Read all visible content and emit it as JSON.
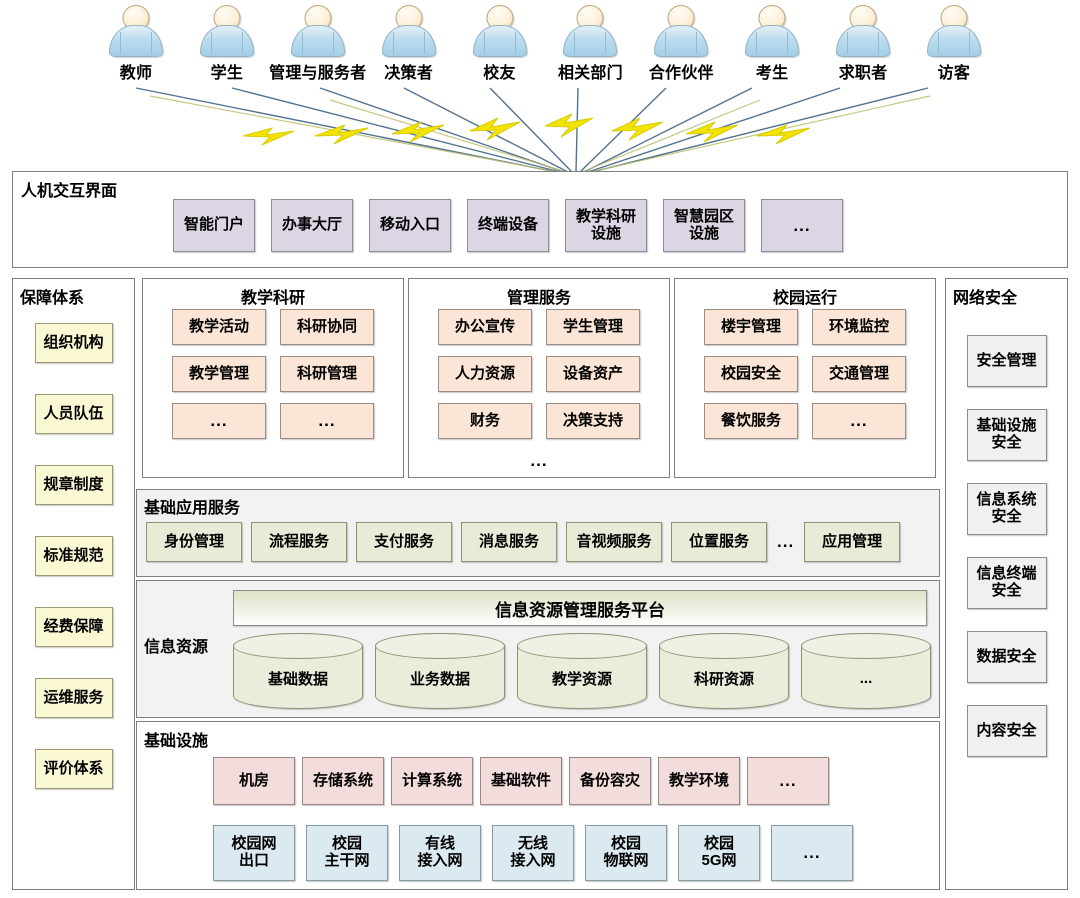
{
  "personas": [
    {
      "label": "教师",
      "icon": "user-icon"
    },
    {
      "label": "学生",
      "icon": "user-icon"
    },
    {
      "label": "管理与服务者",
      "icon": "user-icon"
    },
    {
      "label": "决策者",
      "icon": "user-icon"
    },
    {
      "label": "校友",
      "icon": "user-icon"
    },
    {
      "label": "相关部门",
      "icon": "user-icon"
    },
    {
      "label": "合作伙伴",
      "icon": "user-icon"
    },
    {
      "label": "考生",
      "icon": "user-icon"
    },
    {
      "label": "求职者",
      "icon": "user-icon"
    },
    {
      "label": "访客",
      "icon": "user-icon"
    }
  ],
  "interaction_layer": {
    "title": "人机交互界面",
    "items": [
      "智能门户",
      "办事大厅",
      "移动入口",
      "终端设备",
      "教学科研\n设施",
      "智慧园区\n设施",
      "..."
    ]
  },
  "guarantee_column": {
    "title": "保障体系",
    "items": [
      "组织机构",
      "人员队伍",
      "规章制度",
      "标准规范",
      "经费保障",
      "运维服务",
      "评价体系"
    ]
  },
  "security_column": {
    "title": "网络安全",
    "items": [
      "安全管理",
      "基础设施\n安全",
      "信息系统\n安全",
      "信息终端\n安全",
      "数据安全",
      "内容安全"
    ]
  },
  "business_groups": [
    {
      "title": "教学科研",
      "items": [
        "教学活动",
        "科研协同",
        "教学管理",
        "科研管理",
        "...",
        "..."
      ],
      "extra_dots": ""
    },
    {
      "title": "管理服务",
      "items": [
        "办公宣传",
        "学生管理",
        "人力资源",
        "设备资产",
        "财务",
        "决策支持"
      ],
      "extra_dots": "..."
    },
    {
      "title": "校园运行",
      "items": [
        "楼宇管理",
        "环境监控",
        "校园安全",
        "交通管理",
        "餐饮服务",
        "..."
      ],
      "extra_dots": ""
    }
  ],
  "app_service_layer": {
    "title": "基础应用服务",
    "items": [
      "身份管理",
      "流程服务",
      "支付服务",
      "消息服务",
      "音视频服务",
      "位置服务"
    ],
    "dots": "...",
    "trailing_item": "应用管理"
  },
  "info_resource_layer": {
    "title": "信息资源",
    "platform": "信息资源管理服务平台",
    "stores": [
      "基础数据",
      "业务数据",
      "教学资源",
      "科研资源",
      "..."
    ]
  },
  "infrastructure_layer": {
    "title": "基础设施",
    "hardware": [
      "机房",
      "存储系统",
      "计算系统",
      "基础软件",
      "备份容灾",
      "教学环境",
      "..."
    ],
    "network": [
      "校园网\n出口",
      "校园\n主干网",
      "有线\n接入网",
      "无线\n接入网",
      "校园\n物联网",
      "校园\n5G网",
      "..."
    ]
  },
  "colors": {
    "interaction": "#dcd5e3",
    "guarantee": "#fbf8d4",
    "security": "#f0f0f0",
    "business": "#fae5d7",
    "app_service": "#e8ecd7",
    "info_resource": "#e9eedb",
    "infra_hardware": "#f3dcdc",
    "infra_network": "#dbeaf1",
    "bolt": "#f2e300",
    "connector": "#4a6b8a"
  }
}
